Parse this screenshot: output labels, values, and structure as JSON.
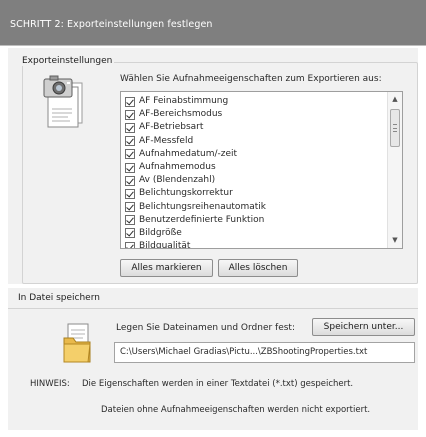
{
  "header": {
    "title": "SCHRITT 2: Exporteinstellungen festlegen"
  },
  "export_group": {
    "title": "Exporteinstellungen",
    "icon": "camera-document-icon",
    "props_label": "Wählen Sie Aufnahmeeigenschaften zum Exportieren aus:",
    "items": [
      {
        "label": "AF Feinabstimmung",
        "checked": true
      },
      {
        "label": "AF-Bereichsmodus",
        "checked": true
      },
      {
        "label": "AF-Betriebsart",
        "checked": true
      },
      {
        "label": "AF-Messfeld",
        "checked": true
      },
      {
        "label": "Aufnahmedatum/-zeit",
        "checked": true
      },
      {
        "label": "Aufnahmemodus",
        "checked": true
      },
      {
        "label": "Av (Blendenzahl)",
        "checked": true
      },
      {
        "label": "Belichtungskorrektur",
        "checked": true
      },
      {
        "label": "Belichtungsreihenautomatik",
        "checked": true
      },
      {
        "label": "Benutzerdefinierte Funktion",
        "checked": true
      },
      {
        "label": "Bildgröße",
        "checked": true
      },
      {
        "label": "Bildqualität",
        "checked": true
      }
    ],
    "select_all_label": "Alles markieren",
    "clear_all_label": "Alles löschen"
  },
  "save_group": {
    "title": "In Datei speichern",
    "icon": "folder-document-icon",
    "label": "Legen Sie Dateinamen und Ordner fest:",
    "save_as_label": "Speichern unter...",
    "path_value": "C:\\Users\\Michael Gradias\\Pictu...\\ZBShootingProperties.txt"
  },
  "note": {
    "label": "HINWEIS:",
    "line1": "Die Eigenschaften werden in einer Textdatei (*.txt) gespeichert.",
    "line2": "Dateien ohne Aufnahmeeigenschaften werden nicht exportiert."
  },
  "colors": {
    "header_bg": "#7f7f7f",
    "panel_bg": "#f1f1f1"
  }
}
